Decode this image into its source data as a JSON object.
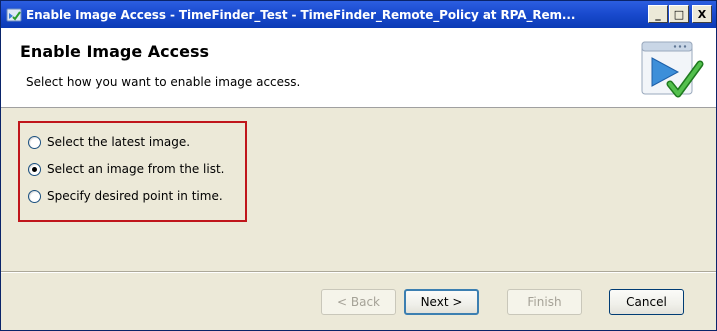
{
  "window": {
    "title": "Enable Image Access - TimeFinder_Test - TimeFinder_Remote_Policy at RPA_Rem...",
    "title_icon": "wizard-app-icon",
    "buttons": {
      "minimize": "_",
      "maximize": "□",
      "close": "X"
    }
  },
  "header": {
    "title": "Enable Image Access",
    "subtitle": "Select how you want to enable image access.",
    "graphic": "wizard-checkmark-graphic"
  },
  "options": [
    {
      "label": "Select the latest image.",
      "checked": false
    },
    {
      "label": "Select an image from the list.",
      "checked": true
    },
    {
      "label": "Specify desired point in time.",
      "checked": false
    }
  ],
  "highlight_color": "#c0161b",
  "footer": {
    "back_label": "< Back",
    "next_label": "Next >",
    "finish_label": "Finish",
    "cancel_label": "Cancel"
  }
}
